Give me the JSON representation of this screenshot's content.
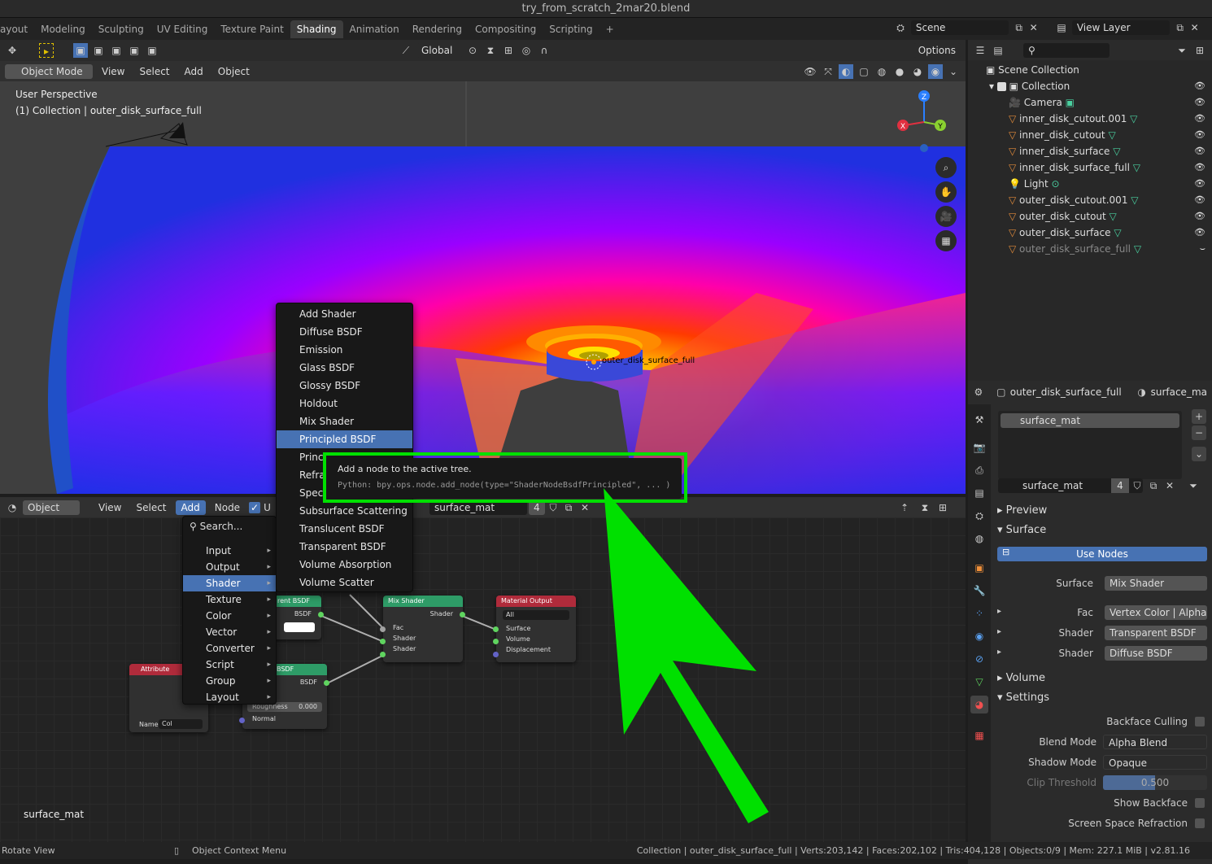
{
  "window": {
    "title": "try_from_scratch_2mar20.blend"
  },
  "workspaces": [
    "ayout",
    "Modeling",
    "Sculpting",
    "UV Editing",
    "Texture Paint",
    "Shading",
    "Animation",
    "Rendering",
    "Compositing",
    "Scripting",
    "+"
  ],
  "active_workspace": "Shading",
  "scene": {
    "label": "Scene",
    "view_layer": "View Layer"
  },
  "viewport_header": {
    "transform": "Global",
    "options": "Options",
    "mode": "Object Mode",
    "menus": [
      "View",
      "Select",
      "Add",
      "Object"
    ]
  },
  "viewport": {
    "perspective": "User Perspective",
    "collection_line": "(1) Collection | outer_disk_surface_full",
    "object_label": "outer_disk_surface_full",
    "gizmo": {
      "z": "Z",
      "x": "X",
      "y": "Y"
    }
  },
  "node_header": {
    "mode": "Object",
    "menus": [
      "View",
      "Select",
      "Add",
      "Node"
    ],
    "use_nodes_short": "U",
    "material": "surface_mat",
    "users": "4"
  },
  "add_menu": {
    "search": "Search...",
    "items": [
      "Input",
      "Output",
      "Shader",
      "Texture",
      "Color",
      "Vector",
      "Converter",
      "Script",
      "Group",
      "Layout"
    ],
    "active": "Shader"
  },
  "shader_menu": {
    "items": [
      "Add Shader",
      "Diffuse BSDF",
      "Emission",
      "Glass BSDF",
      "Glossy BSDF",
      "Holdout",
      "Mix Shader",
      "Principled BSDF",
      "Principled Volume",
      "Refraction BSDF",
      "Specular",
      "Subsurface Scattering",
      "Translucent BSDF",
      "Transparent BSDF",
      "Volume Absorption",
      "Volume Scatter"
    ],
    "visible_text": [
      "Add Shader",
      "Diffuse BSDF",
      "Emission",
      "Glass BSDF",
      "Glossy BSDF",
      "Holdout",
      "Mix Shader",
      "Principled BSDF",
      "Princi",
      "Refra",
      "Spec",
      "Subsurface Scattering",
      "Translucent BSDF",
      "Transparent BSDF",
      "Volume Absorption",
      "Volume Scatter"
    ],
    "highlighted": "Principled BSDF"
  },
  "tooltip": {
    "title": "Add a node to the active tree.",
    "python": "Python: bpy.ops.node.add_node(type=\"ShaderNodeBsdfPrincipled\", ... )"
  },
  "nodes": {
    "transparent": {
      "title": "rent BSDF",
      "out": "BSDF"
    },
    "diffuse": {
      "title": "BSDF",
      "out": "BSDF",
      "roughness_label": "Roughness",
      "roughness": "0.000",
      "normal": "Normal"
    },
    "attribute": {
      "title": "Attribute",
      "name_label": "Name:",
      "name": "Col"
    },
    "mix": {
      "title": "Mix Shader",
      "out": "Shader",
      "inputs": [
        "Fac",
        "Shader",
        "Shader"
      ]
    },
    "output": {
      "title": "Material Output",
      "target": "All",
      "inputs": [
        "Surface",
        "Volume",
        "Displacement"
      ]
    }
  },
  "node_editor": {
    "material_label": "surface_mat"
  },
  "outliner": {
    "root": "Scene Collection",
    "collection": "Collection",
    "items": [
      "Camera",
      "inner_disk_cutout.001",
      "inner_disk_cutout",
      "inner_disk_surface",
      "inner_disk_surface_full",
      "Light",
      "outer_disk_cutout.001",
      "outer_disk_cutout",
      "outer_disk_surface",
      "outer_disk_surface_full"
    ]
  },
  "properties": {
    "object": "outer_disk_surface_full",
    "material_tab": "surface_ma",
    "slot": "surface_mat",
    "material": "surface_mat",
    "users": "4",
    "sections": {
      "preview": "Preview",
      "surface": "Surface",
      "volume": "Volume",
      "settings": "Settings"
    },
    "use_nodes": "Use Nodes",
    "surface_label": "Surface",
    "surface_value": "Mix Shader",
    "fac_label": "Fac",
    "fac_value": "Vertex Color | Alpha",
    "shader1_label": "Shader",
    "shader1_value": "Transparent BSDF",
    "shader2_label": "Shader",
    "shader2_value": "Diffuse BSDF",
    "backface_culling": "Backface Culling",
    "blend_mode_label": "Blend Mode",
    "blend_mode": "Alpha Blend",
    "shadow_mode_label": "Shadow Mode",
    "shadow_mode": "Opaque",
    "clip_label": "Clip Threshold",
    "clip_value": "0.500",
    "show_backface": "Show Backface",
    "ssr": "Screen Space Refraction"
  },
  "statusbar": {
    "left": "Rotate View",
    "middle": "Object Context Menu",
    "right": "Collection | outer_disk_surface_full | Verts:203,142 | Faces:202,102 | Tris:404,128 | Objects:0/9 | Mem: 227.1 MiB | v2.81.16"
  },
  "colors": {
    "accent": "#4772b3",
    "annotation": "#00e000",
    "shader_node": "#2e9c67",
    "output_node": "#b02b3b"
  }
}
